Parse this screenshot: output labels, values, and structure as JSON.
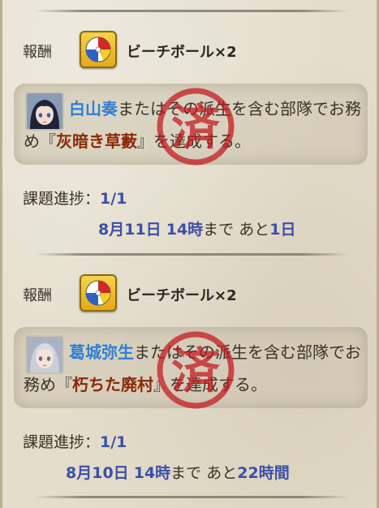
{
  "quests": [
    {
      "reward_label": "報酬",
      "reward_item": "ビーチボール×2",
      "character_name": "白山奏",
      "req_part1": "またはその派生を含む部隊でお務め『",
      "mission_name": "灰暗き草藪",
      "req_part2": "』を達成する。",
      "stamp_text": "済",
      "progress_label": "課題進捗：",
      "progress_value": "1/1",
      "deadline_date": "8月11日",
      "deadline_time": "14時",
      "deadline_until": "まで",
      "deadline_remaining_prefix": "あと",
      "deadline_remaining": "1日"
    },
    {
      "reward_label": "報酬",
      "reward_item": "ビーチボール×2",
      "character_name": "葛城弥生",
      "req_part1": "またはその派生を含む部隊でお務め『",
      "mission_name": "朽ちた廃村",
      "req_part2": "』を達成する。",
      "stamp_text": "済",
      "progress_label": "課題進捗：",
      "progress_value": "1/1",
      "deadline_date": "8月10日",
      "deadline_time": "14時",
      "deadline_until": "まで",
      "deadline_remaining_prefix": "あと",
      "deadline_remaining": "22時間"
    }
  ],
  "colors": {
    "character_name": "#2f7fd6",
    "mission_name": "#8a2a08",
    "highlight": "#3c4fa8",
    "stamp": "#c4161c"
  },
  "icons": {
    "reward_item": "beach-ball-icon",
    "stamp": "completed-stamp-icon"
  }
}
